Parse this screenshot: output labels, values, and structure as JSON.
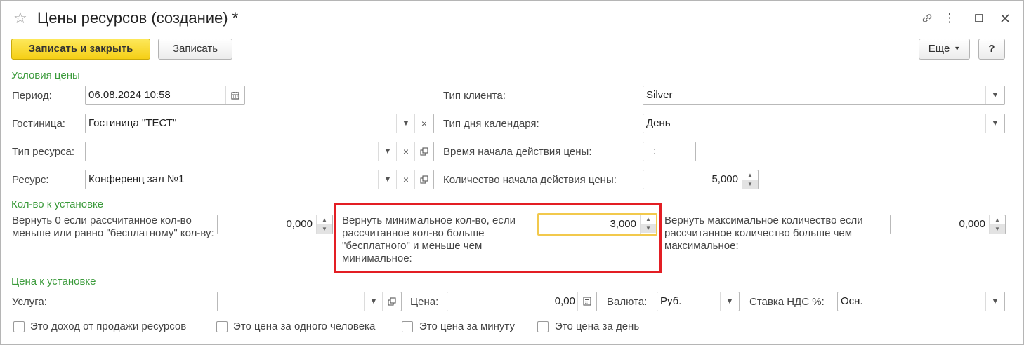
{
  "window": {
    "title": "Цены ресурсов (создание) *"
  },
  "toolbar": {
    "save_close": "Записать и закрыть",
    "save": "Записать",
    "more": "Еще",
    "help": "?"
  },
  "sections": {
    "price_conditions": "Условия цены",
    "quantity": "Кол-во к установке",
    "price": "Цена к установке"
  },
  "left_fields": {
    "period": {
      "label": "Период:",
      "value": "06.08.2024 10:58"
    },
    "hotel": {
      "label": "Гостиница:",
      "value": "Гостиница \"ТЕСТ\""
    },
    "resource_type": {
      "label": "Тип ресурса:",
      "value": ""
    },
    "resource": {
      "label": "Ресурс:",
      "value": "Конференц зал №1"
    }
  },
  "right_fields": {
    "client_type": {
      "label": "Тип клиента:",
      "value": "Silver"
    },
    "day_type": {
      "label": "Тип дня календаря:",
      "value": "День"
    },
    "start_time": {
      "label": "Время начала действия цены:",
      "value": ":"
    },
    "start_qty": {
      "label": "Количество начала действия цены:",
      "value": "5,000"
    }
  },
  "quantity_fields": {
    "zero": {
      "label": "Вернуть 0 если рассчитанное кол-во меньше или равно \"бесплатному\" кол-ву:",
      "value": "0,000"
    },
    "minimum": {
      "label": "Вернуть минимальное кол-во, если рассчитанное кол-во больше \"бесплатного\" и меньше чем минимальное:",
      "value": "3,000"
    },
    "maximum": {
      "label": "Вернуть максимальное количество если рассчитанное количество больше чем максимальное:",
      "value": "0,000"
    }
  },
  "price_fields": {
    "service": {
      "label": "Услуга:",
      "value": ""
    },
    "price": {
      "label": "Цена:",
      "value": "0,00"
    },
    "currency": {
      "label": "Валюта:",
      "value": "Руб."
    },
    "vat": {
      "label": "Ставка НДС %:",
      "value": "Осн."
    }
  },
  "checkboxes": [
    {
      "label": "Это доход от продажи ресурсов",
      "checked": false
    },
    {
      "label": "Это цена за одного человека",
      "checked": false
    },
    {
      "label": "Это цена за минуту",
      "checked": false
    },
    {
      "label": "Это цена за день",
      "checked": false
    }
  ],
  "icons": {
    "favorite": "star-icon",
    "link": "link-icon",
    "menu": "more-vertical-icon",
    "maximize": "maximize-icon",
    "close": "close-icon",
    "calendar": "calendar-icon",
    "calculator": "calculator-icon",
    "open": "open-form-icon",
    "clear": "clear-icon",
    "dropdown": "chevron-down-icon"
  },
  "colors": {
    "primary_button": "#f5cf16",
    "section_title": "#3a9a3a",
    "highlight_border": "#e31e24",
    "focus_border": "#f2c94c"
  }
}
